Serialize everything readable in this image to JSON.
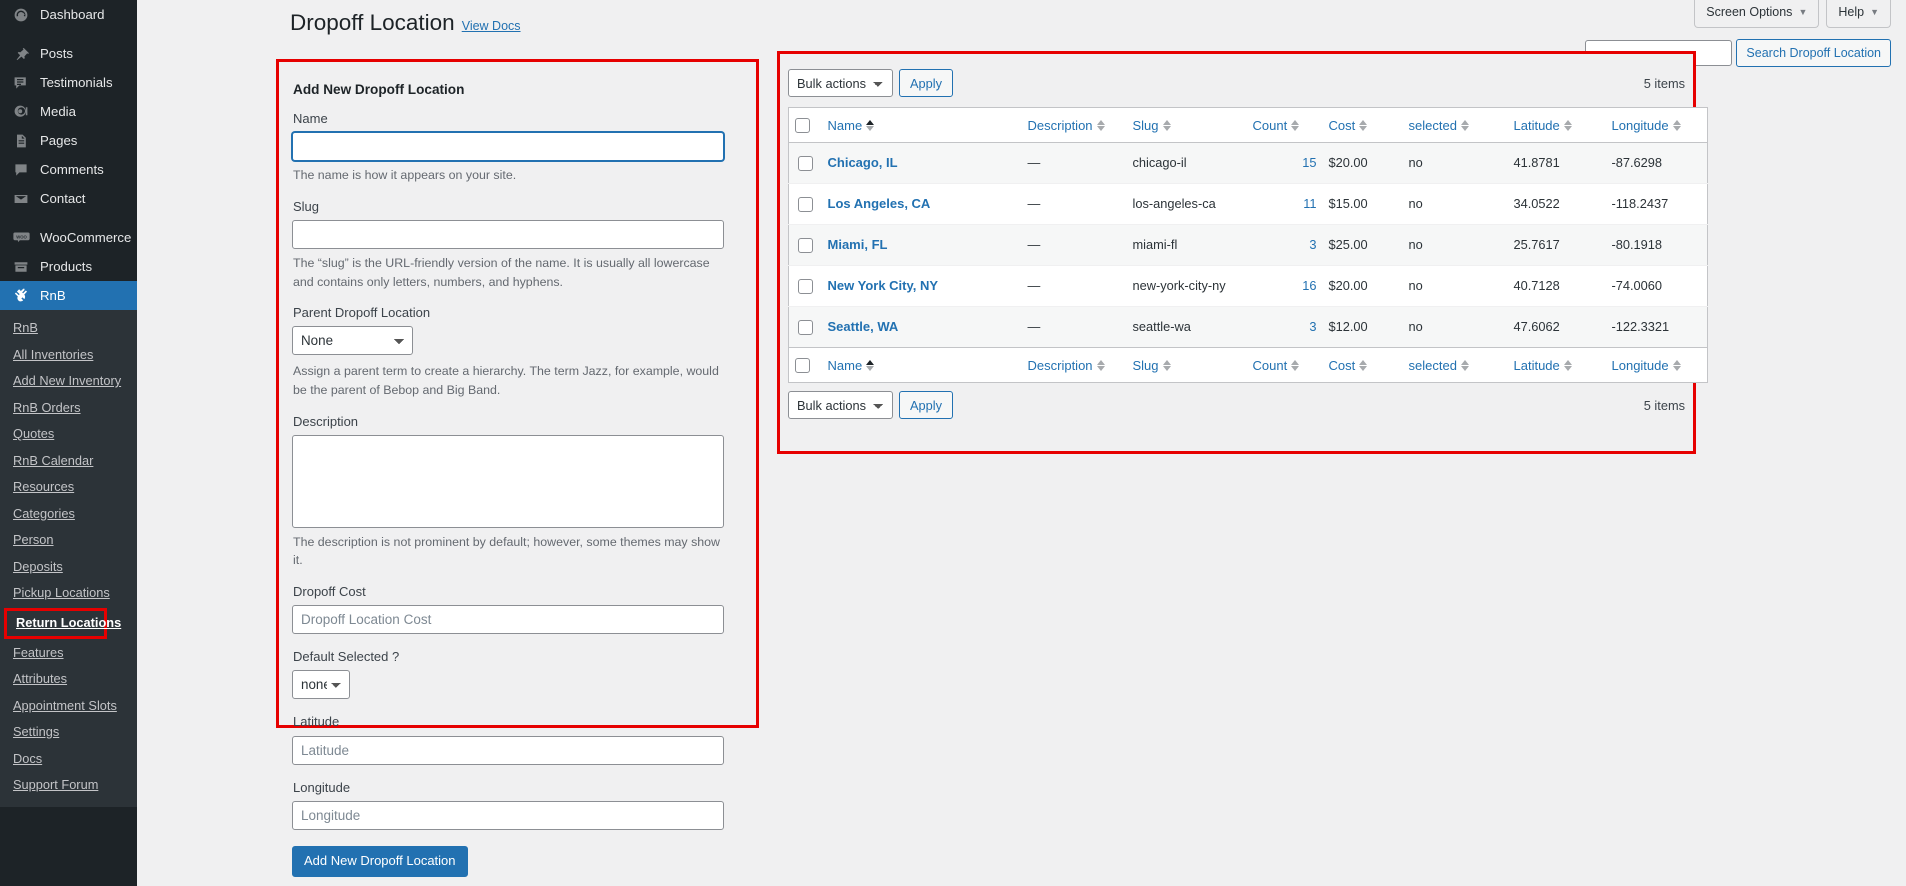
{
  "sidebar": {
    "main_items": [
      {
        "label": "Dashboard",
        "icon": "dashboard-icon",
        "gap_after": true
      },
      {
        "label": "Posts",
        "icon": "pin-icon",
        "gap_after": false
      },
      {
        "label": "Testimonials",
        "icon": "testimonial-icon",
        "gap_after": false
      },
      {
        "label": "Media",
        "icon": "media-icon",
        "gap_after": false
      },
      {
        "label": "Pages",
        "icon": "pages-icon",
        "gap_after": false
      },
      {
        "label": "Comments",
        "icon": "comments-icon",
        "gap_after": false
      },
      {
        "label": "Contact",
        "icon": "envelope-icon",
        "gap_after": true
      },
      {
        "label": "WooCommerce",
        "icon": "woocommerce-icon",
        "gap_after": false
      },
      {
        "label": "Products",
        "icon": "products-icon",
        "gap_after": false
      }
    ],
    "active_item": {
      "label": "RnB",
      "icon": "rnb-icon"
    },
    "submenu": [
      {
        "label": "RnB",
        "current": false
      },
      {
        "label": "All Inventories",
        "current": false
      },
      {
        "label": "Add New Inventory",
        "current": false
      },
      {
        "label": "RnB Orders",
        "current": false
      },
      {
        "label": "Quotes",
        "current": false
      },
      {
        "label": "RnB Calendar",
        "current": false
      },
      {
        "label": "Resources",
        "current": false
      },
      {
        "label": "Categories",
        "current": false
      },
      {
        "label": "Person",
        "current": false
      },
      {
        "label": "Deposits",
        "current": false
      },
      {
        "label": "Pickup Locations",
        "current": false
      },
      {
        "label": "Return Locations",
        "current": true
      },
      {
        "label": "Features",
        "current": false
      },
      {
        "label": "Attributes",
        "current": false
      },
      {
        "label": "Appointment Slots",
        "current": false
      },
      {
        "label": "Settings",
        "current": false
      },
      {
        "label": "Docs",
        "current": false
      },
      {
        "label": "Support Forum",
        "current": false
      }
    ]
  },
  "header": {
    "screen_options": "Screen Options",
    "help": "Help",
    "title": "Dropoff Location",
    "view_docs": "View Docs"
  },
  "search": {
    "value": "",
    "placeholder": "",
    "button_label": "Search Dropoff Location"
  },
  "form": {
    "heading": "Add New Dropoff Location",
    "name_label": "Name",
    "name_value": "",
    "name_help": "The name is how it appears on your site.",
    "slug_label": "Slug",
    "slug_value": "",
    "slug_help": "The “slug” is the URL-friendly version of the name. It is usually all lowercase and contains only letters, numbers, and hyphens.",
    "parent_label": "Parent Dropoff Location",
    "parent_value": "None",
    "parent_options": [
      "None"
    ],
    "parent_help": "Assign a parent term to create a hierarchy. The term Jazz, for example, would be the parent of Bebop and Big Band.",
    "description_label": "Description",
    "description_value": "",
    "description_help": "The description is not prominent by default; however, some themes may show it.",
    "cost_label": "Dropoff Cost",
    "cost_value": "",
    "cost_placeholder": "Dropoff Location Cost",
    "default_selected_label": "Default Selected ?",
    "default_selected_value": "none",
    "default_selected_options": [
      "none"
    ],
    "latitude_label": "Latitude",
    "latitude_value": "",
    "latitude_placeholder": "Latitude",
    "longitude_label": "Longitude",
    "longitude_value": "",
    "longitude_placeholder": "Longitude",
    "submit_label": "Add New Dropoff Location"
  },
  "table": {
    "bulk_actions_label": "Bulk actions",
    "bulk_actions_options": [
      "Bulk actions"
    ],
    "apply_label": "Apply",
    "items_count_top": "5 items",
    "items_count_bottom": "5 items",
    "columns": [
      {
        "key": "name",
        "label": "Name",
        "sorted": "asc"
      },
      {
        "key": "description",
        "label": "Description",
        "sorted": "none"
      },
      {
        "key": "slug",
        "label": "Slug",
        "sorted": "none"
      },
      {
        "key": "count",
        "label": "Count",
        "sorted": "none"
      },
      {
        "key": "cost",
        "label": "Cost",
        "sorted": "none"
      },
      {
        "key": "selected",
        "label": "selected",
        "sorted": "none"
      },
      {
        "key": "latitude",
        "label": "Latitude",
        "sorted": "none"
      },
      {
        "key": "longitude",
        "label": "Longitude",
        "sorted": "none"
      }
    ],
    "rows": [
      {
        "name": "Chicago, IL",
        "description": "—",
        "slug": "chicago-il",
        "count": "15",
        "cost": "$20.00",
        "selected": "no",
        "latitude": "41.8781",
        "longitude": "-87.6298"
      },
      {
        "name": "Los Angeles, CA",
        "description": "—",
        "slug": "los-angeles-ca",
        "count": "11",
        "cost": "$15.00",
        "selected": "no",
        "latitude": "34.0522",
        "longitude": "-118.2437"
      },
      {
        "name": "Miami, FL",
        "description": "—",
        "slug": "miami-fl",
        "count": "3",
        "cost": "$25.00",
        "selected": "no",
        "latitude": "25.7617",
        "longitude": "-80.1918"
      },
      {
        "name": "New York City, NY",
        "description": "—",
        "slug": "new-york-city-ny",
        "count": "16",
        "cost": "$20.00",
        "selected": "no",
        "latitude": "40.7128",
        "longitude": "-74.0060"
      },
      {
        "name": "Seattle, WA",
        "description": "—",
        "slug": "seattle-wa",
        "count": "3",
        "cost": "$12.00",
        "selected": "no",
        "latitude": "47.6062",
        "longitude": "-122.3321"
      }
    ]
  },
  "colors": {
    "annotation": "#e60000",
    "accent": "#2271b1",
    "sidebar_bg": "#1d2327",
    "submenu_bg": "#2c3338"
  }
}
